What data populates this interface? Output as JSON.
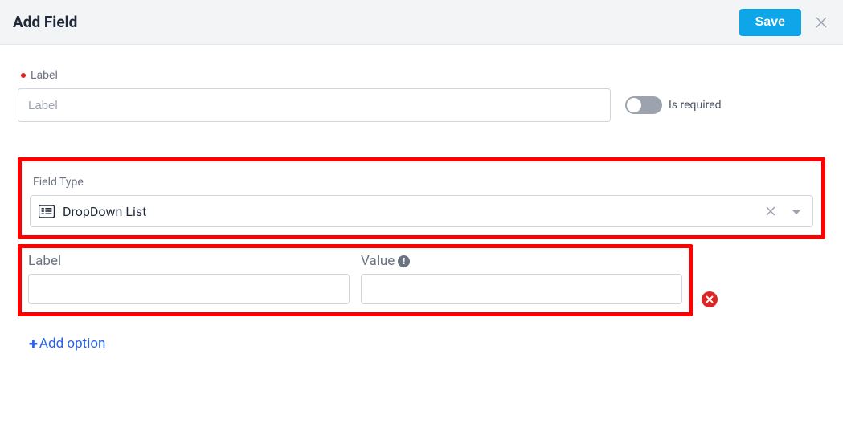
{
  "header": {
    "title": "Add Field",
    "save_label": "Save"
  },
  "form": {
    "label_field_label": "Label",
    "label_placeholder": "Label",
    "is_required_label": "Is required",
    "field_type_label": "Field Type",
    "field_type_value": "DropDown List"
  },
  "option_row": {
    "label_header": "Label",
    "value_header": "Value"
  },
  "add_option_label": "Add option"
}
